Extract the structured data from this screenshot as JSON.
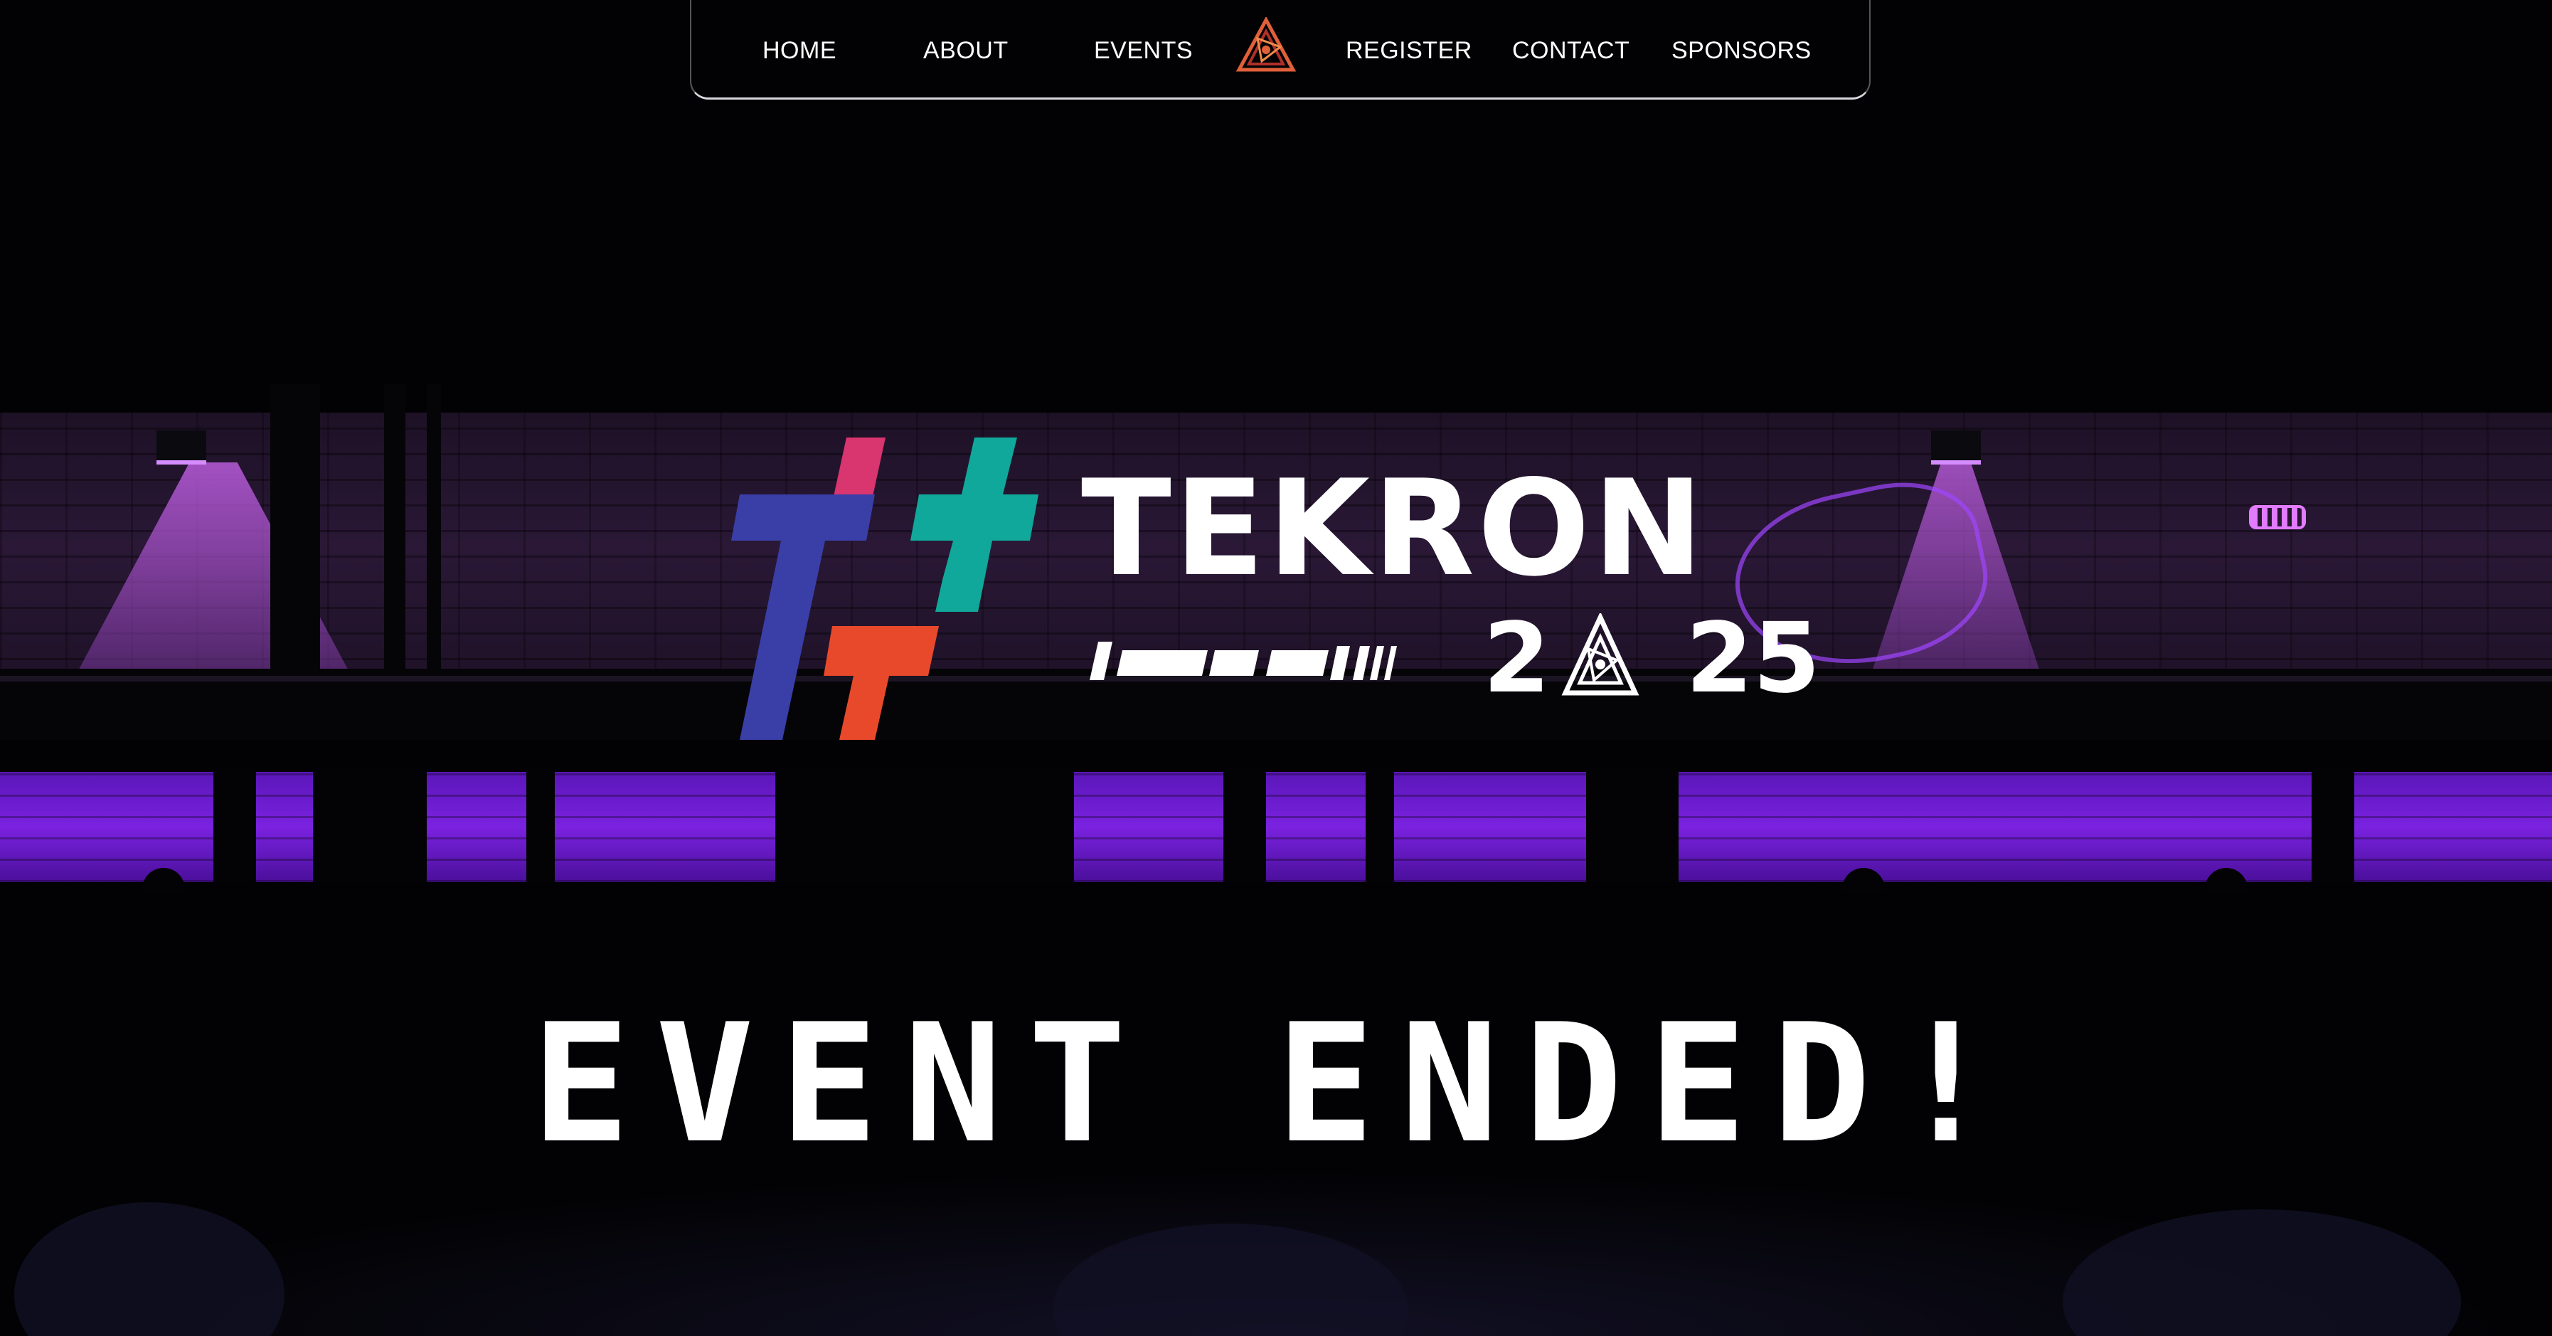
{
  "nav": {
    "items": [
      {
        "label": "HOME"
      },
      {
        "label": "ABOUT"
      },
      {
        "label": "EVENTS"
      },
      {
        "label": "REGISTER"
      },
      {
        "label": "CONTACT"
      },
      {
        "label": "SPONSORS"
      }
    ],
    "logo_icon": "triangle-emblem-icon"
  },
  "hero": {
    "title": "TEKRON",
    "year_left": "2",
    "year_right": "25",
    "logo_icon": "hashtag-t-logo-icon",
    "year_emblem_icon": "triangle-emblem-icon",
    "headline": "EVENT ENDED!"
  },
  "colors": {
    "background": "#020204",
    "hash_blue": "#3a3fa8",
    "hash_pink": "#d9356f",
    "hash_teal": "#10a89a",
    "hash_orange": "#e9492b",
    "scene_purple": "#7a22e0",
    "text": "#ffffff"
  }
}
